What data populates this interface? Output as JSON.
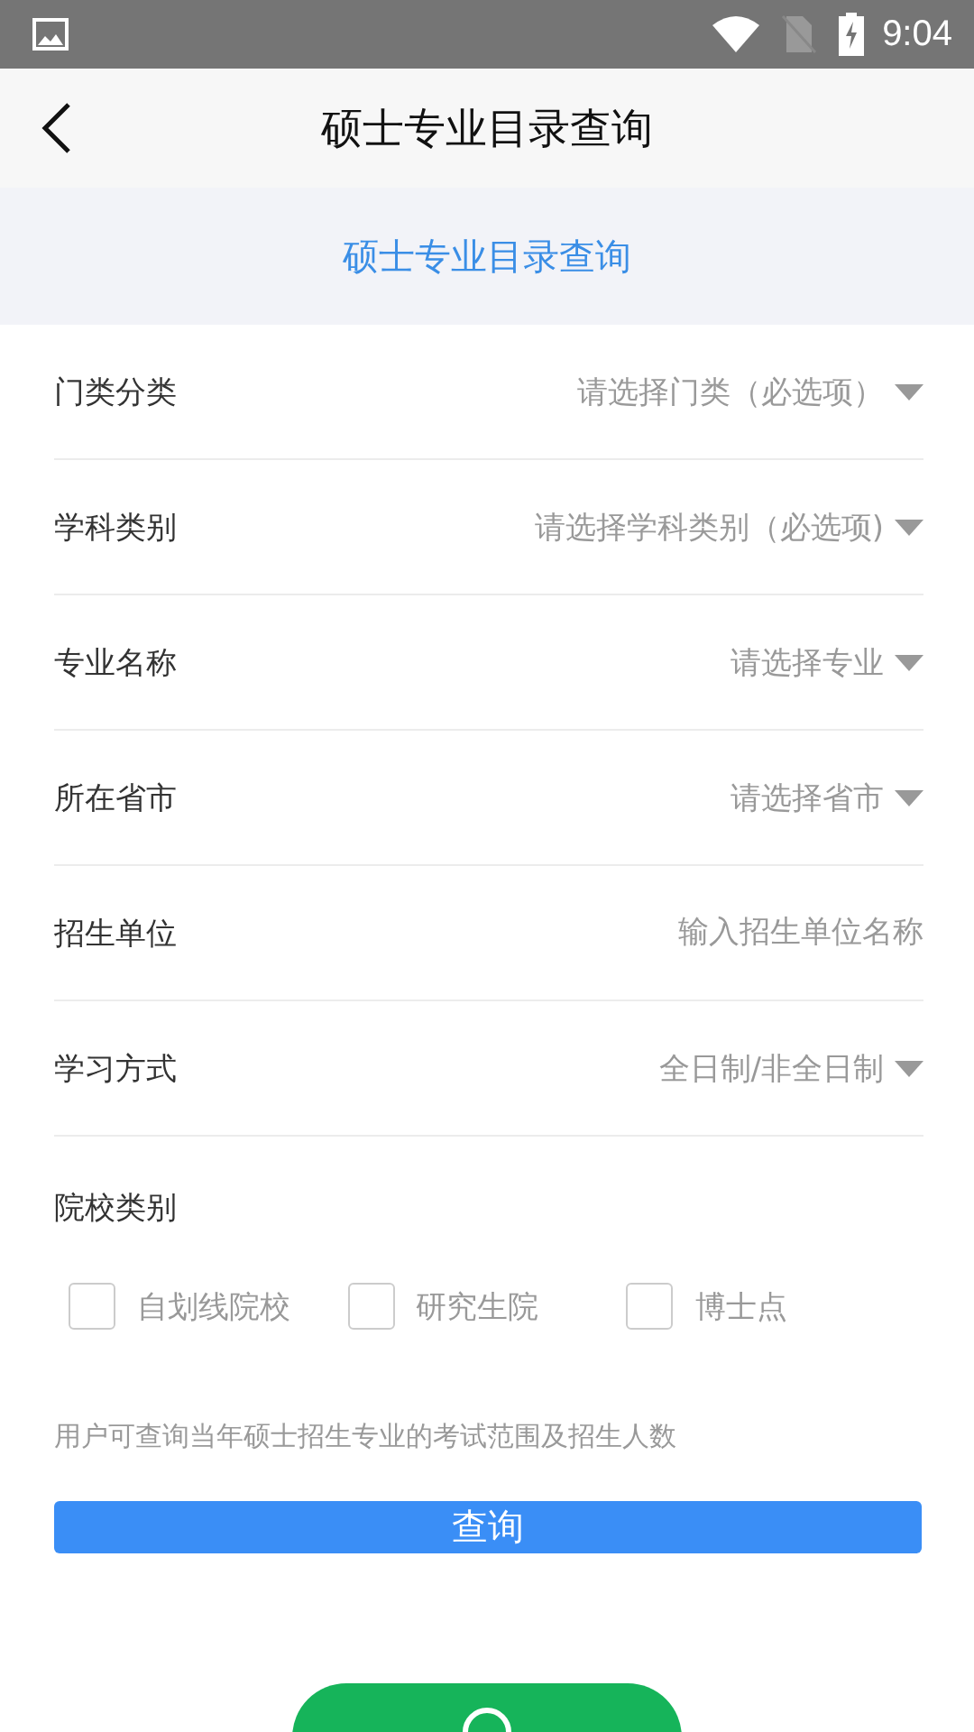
{
  "status_bar": {
    "time": "9:04"
  },
  "header": {
    "title": "硕士专业目录查询"
  },
  "banner": {
    "title": "硕士专业目录查询"
  },
  "fields": [
    {
      "kind": "select",
      "label": "门类分类",
      "placeholder": "请选择门类（必选项）"
    },
    {
      "kind": "select",
      "label": "学科类别",
      "placeholder": "请选择学科类别（必选项)"
    },
    {
      "kind": "select",
      "label": "专业名称",
      "placeholder": "请选择专业"
    },
    {
      "kind": "select",
      "label": "所在省市",
      "placeholder": "请选择省市"
    },
    {
      "kind": "input",
      "label": "招生单位",
      "placeholder": "输入招生单位名称"
    },
    {
      "kind": "select",
      "label": "学习方式",
      "placeholder": "全日制/非全日制"
    }
  ],
  "school_type": {
    "label": "院校类别",
    "options": [
      {
        "label": "自划线院校",
        "checked": false
      },
      {
        "label": "研究生院",
        "checked": false
      },
      {
        "label": "博士点",
        "checked": false
      }
    ]
  },
  "note": "用户可查询当年硕士招生专业的考试范围及招生人数",
  "search_button": "查询",
  "service_button": {
    "shown": true
  }
}
